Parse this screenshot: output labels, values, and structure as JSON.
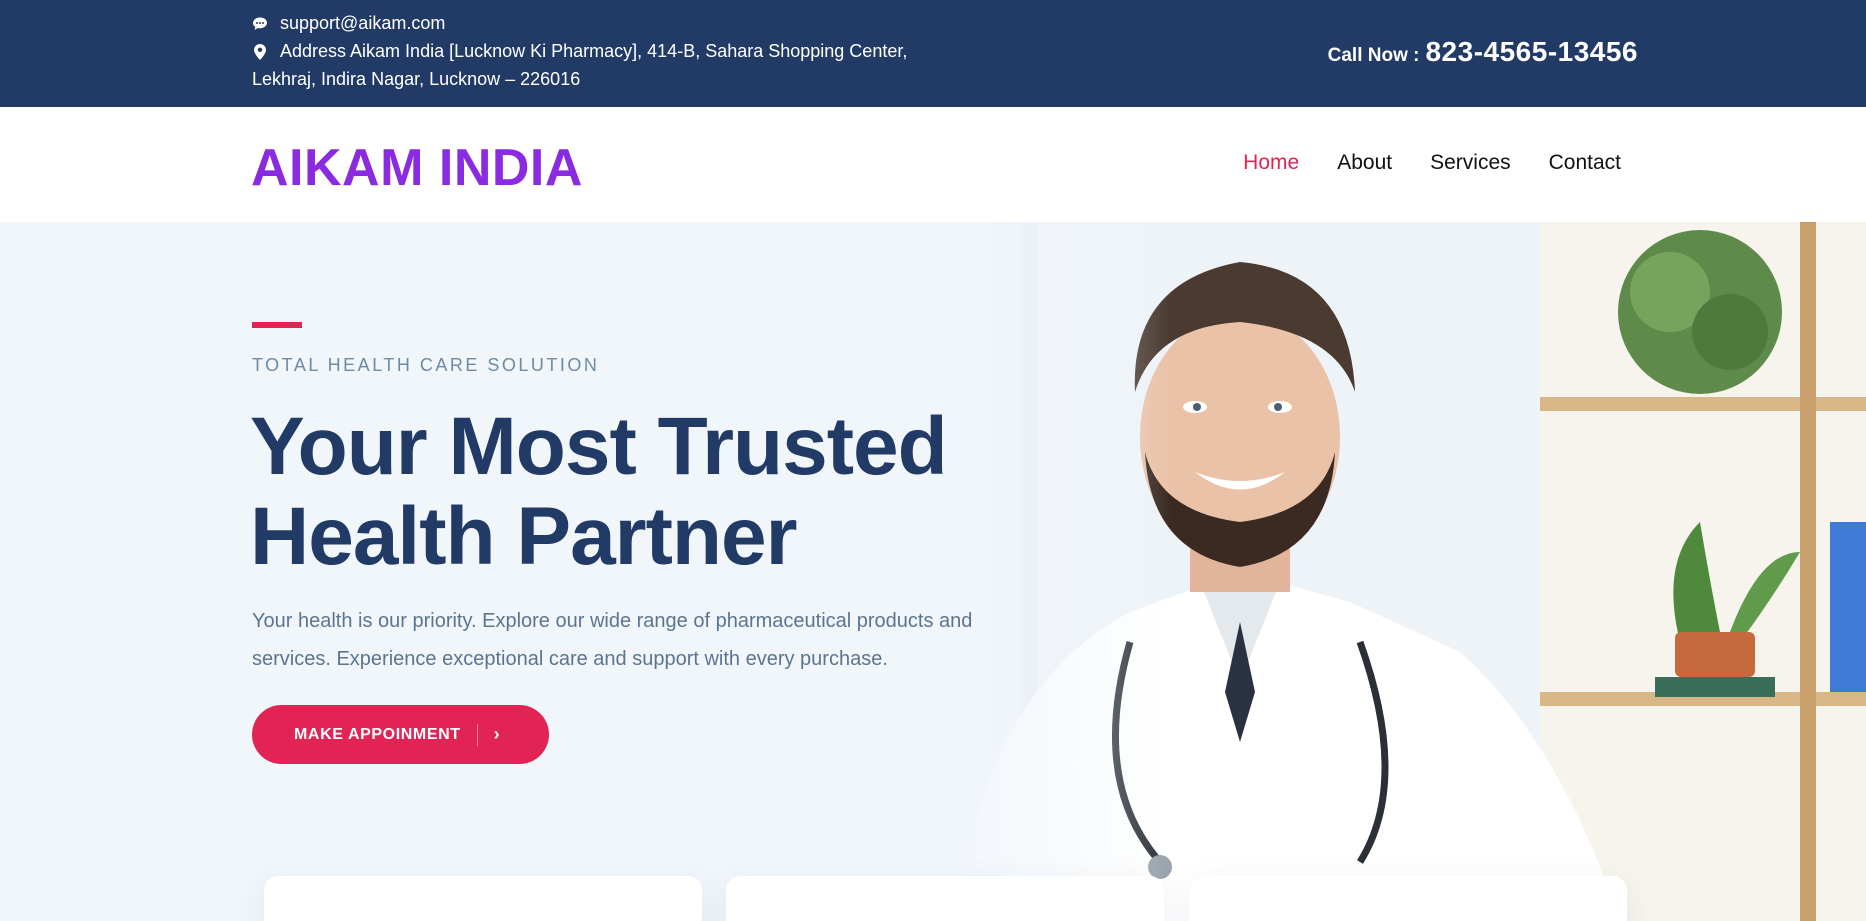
{
  "topbar": {
    "email": "support@aikam.com",
    "address_line1": "Address Aikam India [Lucknow Ki Pharmacy], 414-B, Sahara Shopping Center,",
    "address_line2": "Lekhraj, Indira Nagar, Lucknow – 226016",
    "call_label": "Call Now :",
    "call_number": "823-4565-13456",
    "icons": [
      "chat-bubble-icon",
      "map-pin-icon"
    ]
  },
  "navbar": {
    "brand": "AIKAM INDIA",
    "brand_color": "#8a2be2",
    "links": [
      {
        "label": "Home",
        "active": true
      },
      {
        "label": "About",
        "active": false
      },
      {
        "label": "Services",
        "active": false
      },
      {
        "label": "Contact",
        "active": false
      }
    ]
  },
  "hero": {
    "eyebrow": "TOTAL HEALTH CARE SOLUTION",
    "headline_line1": "Your Most Trusted",
    "headline_line2": "Health Partner",
    "lead": "Your health is our priority. Explore our wide range of pharmaceutical products and services. Experience exceptional care and support with every purchase.",
    "cta_label": "MAKE APPOINMENT",
    "cta_icon": "chevron-right-icon"
  },
  "colors": {
    "primary": "#223a66",
    "accent": "#e12454",
    "muted": "#6f8ba4",
    "hero_bg": "#f1f6fb"
  }
}
